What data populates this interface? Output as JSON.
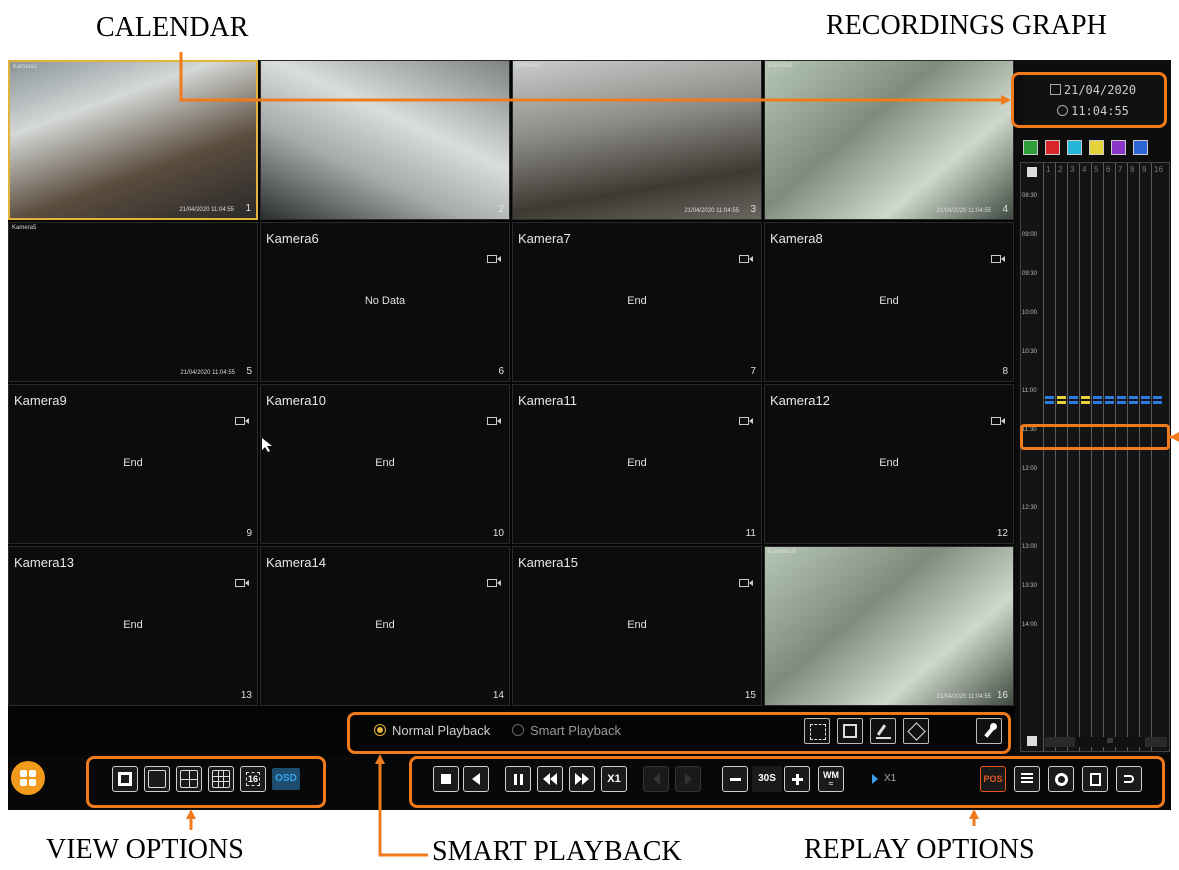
{
  "annotations": {
    "calendar": "CALENDAR",
    "recordings_graph": "RECORDINGS GRAPH",
    "view_options": "VIEW OPTIONS",
    "smart_playback": "SMART PLAYBACK",
    "replay_options": "REPLAY OPTIONS"
  },
  "colors": {
    "highlight": "#f07b1d",
    "selected_camera": "#e3b43a",
    "record_yellow": "#e6d23a",
    "record_blue": "#2e7de0"
  },
  "cameras": [
    {
      "title": "Kamera1",
      "number": "1",
      "status": "",
      "timestamp": "21/04/2020 11:04:55",
      "live": true
    },
    {
      "title": "Kamera2",
      "number": "2",
      "status": "",
      "timestamp": "",
      "live": true
    },
    {
      "title": "Kamera3",
      "number": "3",
      "status": "",
      "timestamp": "21/04/2020 11:04:55",
      "live": true
    },
    {
      "title": "Kamera4",
      "number": "4",
      "status": "",
      "timestamp": "21/04/2020 11:04:55",
      "live": true
    },
    {
      "title": "Kamera5",
      "number": "5",
      "status": "",
      "timestamp": "21/04/2020 11:04:55",
      "live": false
    },
    {
      "title": "Kamera6",
      "number": "6",
      "status": "No Data",
      "timestamp": "",
      "live": false
    },
    {
      "title": "Kamera7",
      "number": "7",
      "status": "End",
      "timestamp": "",
      "live": false
    },
    {
      "title": "Kamera8",
      "number": "8",
      "status": "End",
      "timestamp": "",
      "live": false
    },
    {
      "title": "Kamera9",
      "number": "9",
      "status": "End",
      "timestamp": "",
      "live": false
    },
    {
      "title": "Kamera10",
      "number": "10",
      "status": "End",
      "timestamp": "",
      "live": false
    },
    {
      "title": "Kamera11",
      "number": "11",
      "status": "End",
      "timestamp": "",
      "live": false
    },
    {
      "title": "Kamera12",
      "number": "12",
      "status": "End",
      "timestamp": "",
      "live": false
    },
    {
      "title": "Kamera13",
      "number": "13",
      "status": "End",
      "timestamp": "",
      "live": false
    },
    {
      "title": "Kamera14",
      "number": "14",
      "status": "End",
      "timestamp": "",
      "live": false
    },
    {
      "title": "Kamera15",
      "number": "15",
      "status": "End",
      "timestamp": "",
      "live": false
    },
    {
      "title": "Kamera16",
      "number": "16",
      "status": "",
      "timestamp": "21/04/2020 11:04:55",
      "live": true
    }
  ],
  "calendar": {
    "date": "21/04/2020",
    "time": "11:04:55"
  },
  "graph": {
    "channels": [
      "1",
      "2",
      "3",
      "4",
      "5",
      "6",
      "7",
      "8",
      "9",
      "16"
    ],
    "time_labels": [
      "08:30",
      "09:00",
      "09:30",
      "10:00",
      "10:30",
      "11:00",
      "11:30",
      "12:00",
      "12:30",
      "13:00",
      "13:30",
      "14:00"
    ],
    "recorded_channels_at_11_00": [
      "1",
      "2",
      "3",
      "4",
      "5",
      "6",
      "7",
      "8",
      "9",
      "16"
    ],
    "scroll_label": "III"
  },
  "smart_playback": {
    "normal": "Normal Playback",
    "smart": "Smart Playback",
    "selected": "normal"
  },
  "view_options": {
    "osd": "OSD",
    "sixteen": "16"
  },
  "replay": {
    "speed": "X1",
    "step": "30S",
    "wm": "WM",
    "current_speed": "X1",
    "pos": "POS"
  }
}
